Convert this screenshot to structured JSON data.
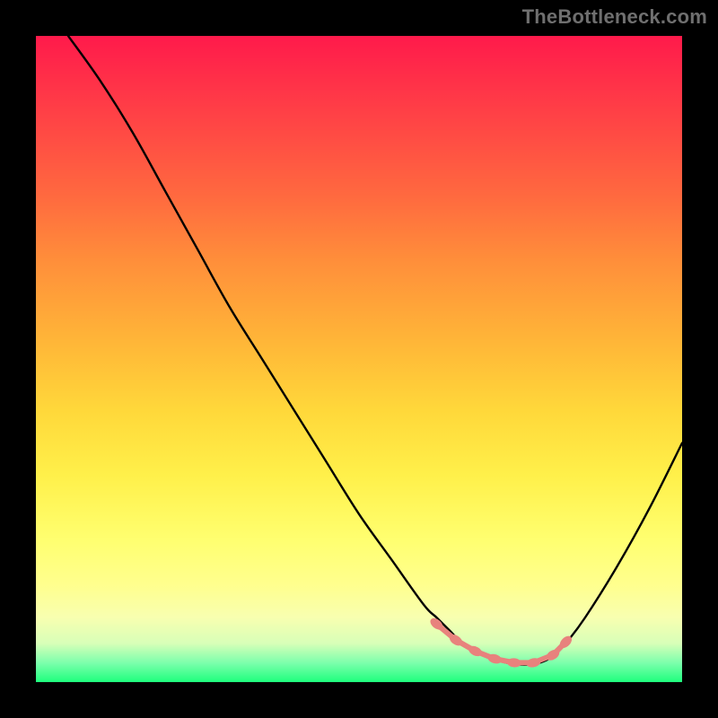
{
  "watermark": "TheBottleneck.com",
  "colors": {
    "frame": "#000000",
    "line": "#000000",
    "bead": "#e8827d",
    "gradient_top": "#ff1a4b",
    "gradient_bottom": "#1eff7d"
  },
  "chart_data": {
    "type": "line",
    "title": "",
    "xlabel": "",
    "ylabel": "",
    "xlim": [
      0,
      100
    ],
    "ylim": [
      0,
      100
    ],
    "note": "Axes are unlabeled; x and y are normalized 0–100 estimated from pixel positions. y=0 is the bottom (green) edge; the curve depicts a bottleneck-style valley.",
    "series": [
      {
        "name": "curve",
        "x": [
          5,
          10,
          15,
          20,
          25,
          30,
          35,
          40,
          45,
          50,
          55,
          60,
          62,
          64,
          66,
          68,
          70,
          72,
          74,
          76,
          78,
          80,
          82,
          85,
          90,
          95,
          100
        ],
        "y": [
          100,
          93,
          85,
          76,
          67,
          58,
          50,
          42,
          34,
          26,
          19,
          12,
          10,
          8,
          6,
          5,
          4,
          3.2,
          2.8,
          2.7,
          3.0,
          4,
          6,
          10,
          18,
          27,
          37
        ]
      }
    ],
    "markers": {
      "name": "valley-beads",
      "x": [
        62,
        65,
        68,
        71,
        74,
        77,
        80,
        82
      ],
      "y": [
        9,
        6.5,
        4.8,
        3.6,
        3.0,
        3.0,
        4.2,
        6.2
      ]
    }
  }
}
